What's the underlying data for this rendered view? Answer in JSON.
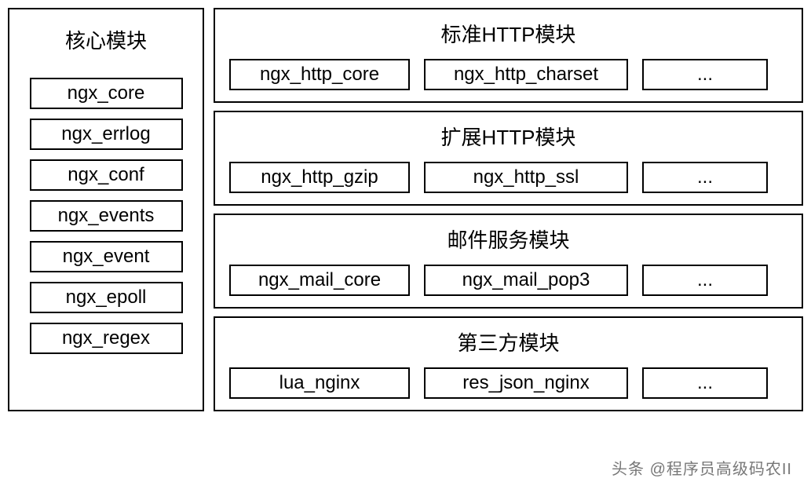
{
  "left": {
    "title": "核心模块",
    "items": [
      "ngx_core",
      "ngx_errlog",
      "ngx_conf",
      "ngx_events",
      "ngx_event",
      "ngx_epoll",
      "ngx_regex"
    ]
  },
  "right": [
    {
      "title": "标准HTTP模块",
      "items": [
        "ngx_http_core",
        "ngx_http_charset",
        "..."
      ]
    },
    {
      "title": "扩展HTTP模块",
      "items": [
        "ngx_http_gzip",
        "ngx_http_ssl",
        "..."
      ]
    },
    {
      "title": "邮件服务模块",
      "items": [
        "ngx_mail_core",
        "ngx_mail_pop3",
        "..."
      ]
    },
    {
      "title": "第三方模块",
      "items": [
        "lua_nginx",
        "res_json_nginx",
        "..."
      ]
    }
  ],
  "watermark": "头条 @程序员高级码农II"
}
